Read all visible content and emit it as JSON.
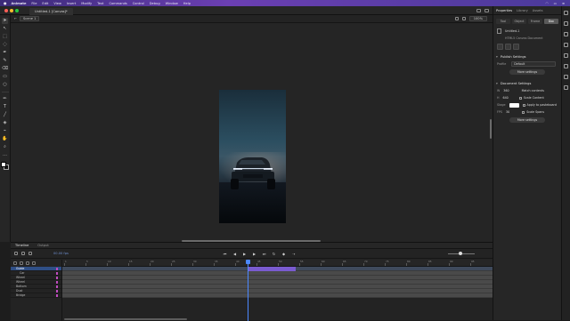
{
  "menubar": {
    "apple": "",
    "app_name": "Animate",
    "items": [
      "File",
      "Edit",
      "View",
      "Insert",
      "Modify",
      "Text",
      "Commands",
      "Control",
      "Debug",
      "Window",
      "Help"
    ]
  },
  "header": {
    "tabs": [
      {
        "label": "Untitled-1 [Canvas]*",
        "active": true
      }
    ],
    "scene_label": "Scene 1",
    "zoom": "100%"
  },
  "timeline": {
    "tabs": [
      "Timeline",
      "Output"
    ],
    "fps_readout": "00.00 fps",
    "frame_labels": [
      "1",
      "5",
      "10",
      "15",
      "20",
      "25",
      "30",
      "35",
      "40",
      "45",
      "50",
      "55",
      "60",
      "65",
      "70",
      "75",
      "80",
      "85",
      "90",
      "95"
    ],
    "layers": [
      {
        "name": "Guide",
        "selected": true
      },
      {
        "name": "Car",
        "selected": false
      },
      {
        "name": "Wheel",
        "selected": false
      },
      {
        "name": "Wheel",
        "selected": false
      },
      {
        "name": "Bottom",
        "selected": false
      },
      {
        "name": "Dust",
        "selected": false
      },
      {
        "name": "Bridge",
        "selected": false
      }
    ]
  },
  "properties": {
    "tabs": [
      "Properties",
      "Library",
      "Assets"
    ],
    "segments": [
      "Tool",
      "Object",
      "Frame",
      "Doc"
    ],
    "active_segment": "Doc",
    "doc_name": "Untitled-1",
    "doc_type": "HTML5 Canvas Document",
    "publish_title": "Publish Settings",
    "profile_label": "Profile",
    "profile_value": "Default",
    "more_settings": "More settings",
    "doc_settings_title": "Document Settings",
    "width_label": "W",
    "width_value": "360",
    "height_label": "H",
    "height_value": "640",
    "match_contents": "Match contents",
    "scale_content": "Scale Content",
    "stage_label": "Stage",
    "apply_pasteboard": "Apply to pasteboard",
    "fps_label": "FPS",
    "fps_value": "30",
    "scale_spans": "Scale Spans",
    "more_settings_2": "More settings"
  },
  "colors": {
    "accent": "#4c88ff",
    "tween": "#7a5bd0",
    "menubar": "#5a3aa0"
  }
}
